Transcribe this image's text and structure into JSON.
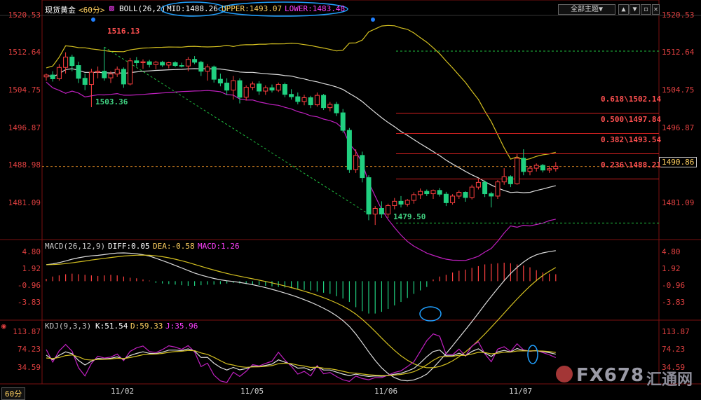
{
  "header": {
    "instrument": "现货黄金",
    "period_tag": "<60分>",
    "indicator": "BOLL(26,2)",
    "mid": "MID:1488.26",
    "upper": "UPPER:1493.07",
    "lower": "LOWER:1483.48",
    "theme_button": "全部主题▼"
  },
  "price_axis": {
    "ticks": [
      "1520.53",
      "1512.64",
      "1504.75",
      "1496.87",
      "1488.98",
      "1481.09"
    ],
    "min": 1476.0,
    "max": 1522.5
  },
  "annotations": {
    "high_label": "1516.13",
    "low1_label": "1503.36",
    "low2_label": "1479.50",
    "current_price": "1490.86"
  },
  "fib_levels": [
    {
      "label": "0.618\\1502.14",
      "value": 1502.14
    },
    {
      "label": "0.500\\1497.84",
      "value": 1497.84
    },
    {
      "label": "0.382\\1493.54",
      "value": 1493.54
    },
    {
      "label": "0.236\\1488.21",
      "value": 1488.21
    }
  ],
  "macd": {
    "header": "MACD(26,12,9)",
    "diff": "DIFF:0.05",
    "dea": "DEA:-0.58",
    "macd": "MACD:1.26",
    "ticks": [
      "4.80",
      "1.92",
      "-0.96",
      "-3.83"
    ],
    "min": -6.5,
    "max": 5.5,
    "histogram": [
      0.4,
      0.8,
      1.0,
      1.2,
      1.3,
      1.2,
      1.1,
      1.0,
      0.9,
      1.0,
      1.1,
      1.0,
      0.8,
      0.6,
      0.5,
      0.3,
      0.1,
      -0.3,
      -0.4,
      -0.5,
      -0.6,
      -0.7,
      -0.8,
      -0.8,
      -0.7,
      -0.6,
      -0.6,
      -0.5,
      -0.4,
      -0.3,
      -0.4,
      -0.5,
      -0.6,
      -0.7,
      -0.8,
      -0.9,
      -1.0,
      -1.1,
      -1.2,
      -1.3,
      -1.5,
      -1.6,
      -1.8,
      -2.0,
      -2.2,
      -2.6,
      -3.0,
      -3.6,
      -4.5,
      -5.2,
      -5.6,
      -5.6,
      -5.3,
      -4.8,
      -4.2,
      -3.6,
      -2.9,
      -2.2,
      -1.6,
      -1.0,
      0.3,
      0.8,
      1.1,
      1.5,
      1.8,
      2.0,
      2.3,
      2.6,
      2.9,
      3.0,
      3.1,
      3.2,
      3.1,
      2.9,
      2.7,
      2.4,
      1.9,
      1.5,
      1.3,
      1.2
    ]
  },
  "kdj": {
    "header": "KDJ(9,3,3)",
    "k": "K:51.54",
    "d": "D:59.33",
    "j": "J:35.96",
    "ticks": [
      "113.87",
      "74.23",
      "34.59"
    ],
    "min": -5,
    "max": 125
  },
  "x_axis": {
    "dates": [
      "11/02",
      "11/05",
      "11/06",
      "11/07"
    ],
    "period_select": "60分"
  },
  "candles": [
    [
      1509.8,
      1510.5,
      1509.0,
      1510.2
    ],
    [
      1510.2,
      1511.0,
      1508.8,
      1509.4
    ],
    [
      1509.4,
      1512.5,
      1509.0,
      1511.8
    ],
    [
      1511.8,
      1515.0,
      1510.5,
      1514.0
    ],
    [
      1514.0,
      1514.5,
      1511.0,
      1512.2
    ],
    [
      1512.2,
      1513.0,
      1508.5,
      1509.5
    ],
    [
      1509.5,
      1510.5,
      1507.0,
      1508.2
    ],
    [
      1508.2,
      1511.5,
      1503.4,
      1510.8
    ],
    [
      1510.8,
      1512.0,
      1509.5,
      1511.0
    ],
    [
      1511.0,
      1516.1,
      1509.0,
      1509.6
    ],
    [
      1509.6,
      1511.0,
      1508.5,
      1510.4
    ],
    [
      1510.4,
      1512.0,
      1509.8,
      1511.4
    ],
    [
      1511.4,
      1511.8,
      1507.5,
      1508.3
    ],
    [
      1508.3,
      1513.8,
      1508.0,
      1513.2
    ],
    [
      1513.2,
      1514.0,
      1512.0,
      1512.8
    ],
    [
      1512.8,
      1513.5,
      1511.5,
      1513.0
    ],
    [
      1513.0,
      1513.4,
      1511.8,
      1512.4
    ],
    [
      1512.4,
      1513.2,
      1511.4,
      1512.9
    ],
    [
      1512.9,
      1513.2,
      1511.9,
      1512.3
    ],
    [
      1512.3,
      1513.0,
      1511.6,
      1512.8
    ],
    [
      1512.8,
      1513.1,
      1511.9,
      1512.2
    ],
    [
      1512.2,
      1512.8,
      1511.8,
      1512.1
    ],
    [
      1512.1,
      1514.0,
      1511.0,
      1513.5
    ],
    [
      1513.5,
      1514.2,
      1512.5,
      1512.9
    ],
    [
      1512.9,
      1513.2,
      1510.0,
      1511.0
    ],
    [
      1511.0,
      1512.5,
      1509.0,
      1511.9
    ],
    [
      1511.9,
      1512.2,
      1508.6,
      1509.3
    ],
    [
      1509.3,
      1510.5,
      1507.8,
      1508.5
    ],
    [
      1508.5,
      1509.5,
      1506.0,
      1507.0
    ],
    [
      1507.0,
      1510.0,
      1505.0,
      1509.0
    ],
    [
      1509.0,
      1509.5,
      1504.2,
      1505.5
    ],
    [
      1505.5,
      1508.0,
      1504.8,
      1507.6
    ],
    [
      1507.6,
      1508.8,
      1507.0,
      1508.3
    ],
    [
      1508.3,
      1508.9,
      1506.0,
      1506.8
    ],
    [
      1506.8,
      1508.0,
      1506.0,
      1507.5
    ],
    [
      1507.5,
      1508.2,
      1506.5,
      1507.0
    ],
    [
      1507.0,
      1508.6,
      1506.6,
      1508.2
    ],
    [
      1508.2,
      1508.6,
      1505.5,
      1506.1
    ],
    [
      1506.1,
      1507.2,
      1505.0,
      1505.6
    ],
    [
      1505.6,
      1506.5,
      1504.0,
      1504.6
    ],
    [
      1504.6,
      1506.0,
      1503.8,
      1505.4
    ],
    [
      1505.4,
      1505.8,
      1503.2,
      1503.9
    ],
    [
      1503.9,
      1506.5,
      1503.5,
      1505.9
    ],
    [
      1505.9,
      1506.2,
      1502.8,
      1503.3
    ],
    [
      1503.3,
      1504.5,
      1502.5,
      1504.0
    ],
    [
      1504.0,
      1504.5,
      1501.5,
      1502.2
    ],
    [
      1502.2,
      1503.0,
      1498.0,
      1498.5
    ],
    [
      1498.5,
      1499.0,
      1489.5,
      1490.2
    ],
    [
      1490.2,
      1494.5,
      1489.5,
      1493.2
    ],
    [
      1493.2,
      1494.0,
      1487.5,
      1488.5
    ],
    [
      1488.5,
      1489.0,
      1479.5,
      1480.8
    ],
    [
      1480.8,
      1482.5,
      1478.5,
      1482.0
    ],
    [
      1482.0,
      1483.5,
      1480.0,
      1480.8
    ],
    [
      1480.8,
      1483.0,
      1480.0,
      1482.6
    ],
    [
      1482.6,
      1484.2,
      1481.8,
      1483.5
    ],
    [
      1483.5,
      1484.6,
      1482.2,
      1482.9
    ],
    [
      1482.9,
      1484.0,
      1482.4,
      1483.7
    ],
    [
      1483.7,
      1485.4,
      1483.0,
      1484.9
    ],
    [
      1484.9,
      1486.2,
      1484.0,
      1485.6
    ],
    [
      1485.6,
      1486.0,
      1484.6,
      1485.1
    ],
    [
      1485.1,
      1486.0,
      1484.0,
      1485.8
    ],
    [
      1485.8,
      1486.3,
      1484.5,
      1485.0
    ],
    [
      1485.0,
      1485.5,
      1482.5,
      1483.2
    ],
    [
      1483.2,
      1485.0,
      1482.8,
      1484.6
    ],
    [
      1484.6,
      1485.8,
      1484.0,
      1485.4
    ],
    [
      1485.4,
      1485.6,
      1483.4,
      1484.3
    ],
    [
      1484.3,
      1487.0,
      1483.9,
      1486.5
    ],
    [
      1486.5,
      1488.2,
      1486.0,
      1487.5
    ],
    [
      1487.5,
      1487.9,
      1484.4,
      1485.1
    ],
    [
      1485.1,
      1485.5,
      1482.2,
      1484.6
    ],
    [
      1484.6,
      1488.0,
      1484.0,
      1487.6
    ],
    [
      1487.6,
      1490.5,
      1487.0,
      1488.7
    ],
    [
      1488.7,
      1489.0,
      1486.5,
      1487.2
    ],
    [
      1487.2,
      1493.5,
      1487.0,
      1492.6
    ],
    [
      1492.6,
      1494.5,
      1489.0,
      1489.8
    ],
    [
      1489.8,
      1491.0,
      1489.0,
      1490.5
    ],
    [
      1490.5,
      1491.5,
      1489.8,
      1491.1
    ],
    [
      1491.1,
      1491.4,
      1489.6,
      1490.1
    ],
    [
      1490.1,
      1491.0,
      1489.5,
      1490.4
    ],
    [
      1490.4,
      1491.8,
      1489.8,
      1490.9
    ]
  ]
}
